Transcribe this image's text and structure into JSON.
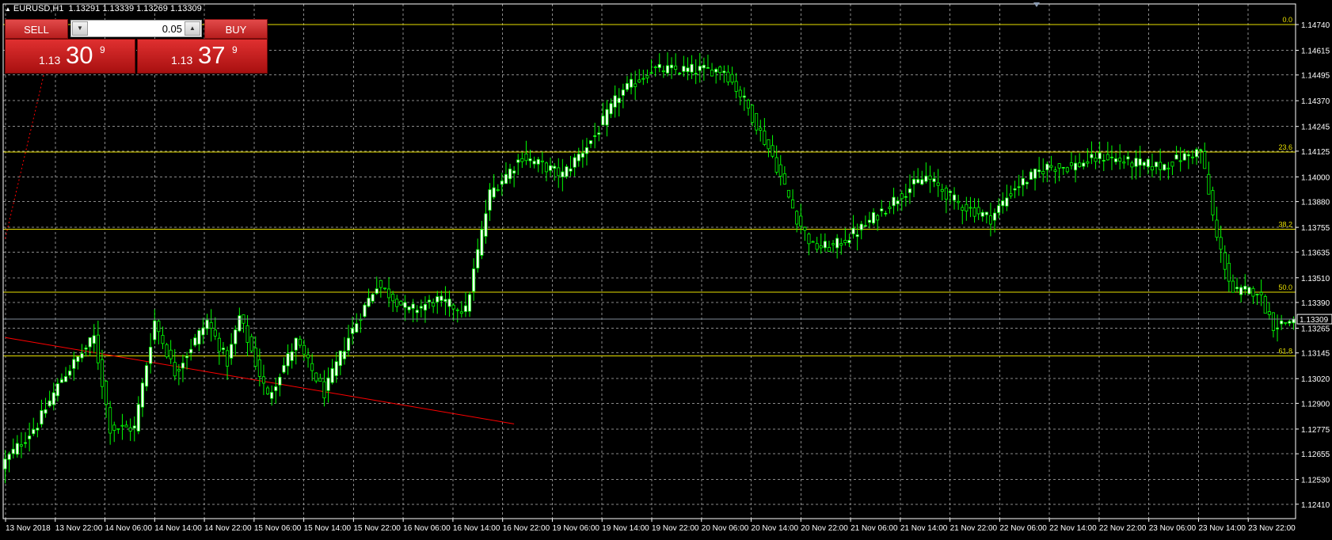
{
  "header": {
    "symbol": "EURUSD,H1",
    "ohlc": "1.13291 1.13339 1.13269 1.13309"
  },
  "trade_panel": {
    "sell_label": "SELL",
    "buy_label": "BUY",
    "lot_value": "0.05",
    "sell_price_small": "1.13",
    "sell_price_big": "30",
    "sell_price_sup": "9",
    "buy_price_small": "1.13",
    "buy_price_big": "37",
    "buy_price_sup": "9"
  },
  "colors": {
    "background": "#000000",
    "grid": "#8a8a8a",
    "candle_up_body": "#ffffff",
    "candle_down_body": "#000000",
    "candle_outline": "#00ff00",
    "fib_line": "#e8e000",
    "trend_line": "#ff0000",
    "bid_line": "#808a98",
    "axis_text": "#ffffff",
    "current_price_bg": "#000000"
  },
  "chart_data": {
    "type": "candlestick",
    "symbol": "EURUSD",
    "timeframe": "H1",
    "ylim": [
      1.1234,
      1.1484
    ],
    "y_ticks": [
      "1.14740",
      "1.14615",
      "1.14495",
      "1.14370",
      "1.14245",
      "1.14125",
      "1.14000",
      "1.13880",
      "1.13755",
      "1.13635",
      "1.13510",
      "1.13390",
      "1.13265",
      "1.13145",
      "1.13020",
      "1.12900",
      "1.12775",
      "1.12655",
      "1.12530",
      "1.12410"
    ],
    "current_price": "1.13309",
    "x_ticks": [
      "13 Nov 2018",
      "13 Nov 22:00",
      "14 Nov 06:00",
      "14 Nov 14:00",
      "14 Nov 22:00",
      "15 Nov 06:00",
      "15 Nov 14:00",
      "15 Nov 22:00",
      "16 Nov 06:00",
      "16 Nov 14:00",
      "16 Nov 22:00",
      "19 Nov 06:00",
      "19 Nov 14:00",
      "19 Nov 22:00",
      "20 Nov 06:00",
      "20 Nov 14:00",
      "20 Nov 22:00",
      "21 Nov 06:00",
      "21 Nov 14:00",
      "21 Nov 22:00",
      "22 Nov 06:00",
      "22 Nov 14:00",
      "22 Nov 22:00",
      "23 Nov 06:00",
      "23 Nov 14:00",
      "23 Nov 22:00"
    ],
    "fibonacci_levels": [
      {
        "label": "0.0",
        "price": 1.1474
      },
      {
        "label": "23.6",
        "price": 1.1412
      },
      {
        "label": "38.2",
        "price": 1.13745
      },
      {
        "label": "50.0",
        "price": 1.1344
      },
      {
        "label": "61.8",
        "price": 1.1313
      }
    ],
    "anchors": [
      {
        "index": 0,
        "close": 1.1262
      },
      {
        "index": 8,
        "close": 1.128
      },
      {
        "index": 14,
        "close": 1.1302
      },
      {
        "index": 22,
        "close": 1.1322
      },
      {
        "index": 26,
        "close": 1.1278
      },
      {
        "index": 32,
        "close": 1.1278
      },
      {
        "index": 37,
        "close": 1.133
      },
      {
        "index": 42,
        "close": 1.1305
      },
      {
        "index": 50,
        "close": 1.133
      },
      {
        "index": 55,
        "close": 1.131
      },
      {
        "index": 58,
        "close": 1.1332
      },
      {
        "index": 65,
        "close": 1.1293
      },
      {
        "index": 72,
        "close": 1.132
      },
      {
        "index": 79,
        "close": 1.1295
      },
      {
        "index": 85,
        "close": 1.1322
      },
      {
        "index": 92,
        "close": 1.1348
      },
      {
        "index": 100,
        "close": 1.1335
      },
      {
        "index": 107,
        "close": 1.134
      },
      {
        "index": 114,
        "close": 1.1335
      },
      {
        "index": 120,
        "close": 1.1392
      },
      {
        "index": 128,
        "close": 1.141
      },
      {
        "index": 138,
        "close": 1.1401
      },
      {
        "index": 146,
        "close": 1.142
      },
      {
        "index": 152,
        "close": 1.144
      },
      {
        "index": 160,
        "close": 1.1452
      },
      {
        "index": 170,
        "close": 1.1452
      },
      {
        "index": 178,
        "close": 1.1452
      },
      {
        "index": 183,
        "close": 1.1437
      },
      {
        "index": 190,
        "close": 1.141
      },
      {
        "index": 196,
        "close": 1.138
      },
      {
        "index": 200,
        "close": 1.1366
      },
      {
        "index": 205,
        "close": 1.1366
      },
      {
        "index": 212,
        "close": 1.1375
      },
      {
        "index": 222,
        "close": 1.1392
      },
      {
        "index": 228,
        "close": 1.14
      },
      {
        "index": 236,
        "close": 1.1387
      },
      {
        "index": 244,
        "close": 1.138
      },
      {
        "index": 250,
        "close": 1.1395
      },
      {
        "index": 258,
        "close": 1.1405
      },
      {
        "index": 264,
        "close": 1.1405
      },
      {
        "index": 272,
        "close": 1.141
      },
      {
        "index": 278,
        "close": 1.1407
      },
      {
        "index": 286,
        "close": 1.1405
      },
      {
        "index": 296,
        "close": 1.1413
      },
      {
        "index": 300,
        "close": 1.137
      },
      {
        "index": 304,
        "close": 1.1344
      },
      {
        "index": 310,
        "close": 1.1345
      },
      {
        "index": 314,
        "close": 1.1328
      },
      {
        "index": 318,
        "close": 1.133
      },
      {
        "index": 319,
        "close": 1.13309
      }
    ],
    "trend_lines": [
      {
        "from": {
          "index": 0,
          "price": 1.1322
        },
        "to": {
          "index": 126,
          "price": 1.128
        },
        "style": "solid"
      },
      {
        "from": {
          "index": 0,
          "price": 1.137
        },
        "to": {
          "index": 12,
          "price": 1.147
        },
        "style": "dotted"
      }
    ]
  }
}
